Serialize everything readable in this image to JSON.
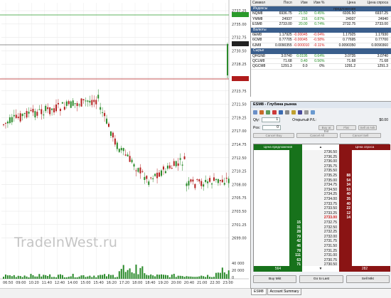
{
  "watermark": "TradeInWest.ru",
  "chart": {
    "y_ticks": [
      "2737.25",
      "2735.00",
      "2732.75",
      "2730.50",
      "2728.25",
      "2726.00",
      "2723.75",
      "2721.50",
      "2719.25",
      "2717.00",
      "2714.75",
      "2712.50",
      "2710.25",
      "2708.00",
      "2705.75",
      "2703.50",
      "2701.25",
      "2699.00"
    ],
    "x_ticks": [
      "06:50",
      "09:00",
      "10:20",
      "11:40",
      "12:40",
      "14:00",
      "15:00",
      "15:40",
      "16:20",
      "17:20",
      "18:00",
      "18:40",
      "19:20",
      "20:00",
      "20:40",
      "21:00",
      "22:30",
      "23:00"
    ],
    "vol_ticks": [
      "40 000",
      "20 000",
      "0"
    ],
    "bid_color": "#1e7a1e",
    "ask_color": "#b01c1c",
    "line_color": "#2a9a2a"
  },
  "quotes": {
    "headers": [
      "Символ",
      "Посл",
      "Изм",
      "Изм %",
      "Цена предложения",
      "Цена спроса"
    ],
    "sections": [
      {
        "name": "Индексы",
        "rows": [
          {
            "sym": "NQM8",
            "last": "6936.75",
            "chg": "21.50",
            "pct": "0.45%",
            "bid": "6936.50",
            "ask": "6937.25",
            "dir": "up"
          },
          {
            "sym": "YMM8",
            "last": "24937",
            "chg": "216",
            "pct": "0.87%",
            "bid": "24937",
            "ask": "24940",
            "dir": "up"
          },
          {
            "sym": "ESM8",
            "last": "2733.00",
            "chg": "20.00",
            "pct": "0.74%",
            "bid": "2732.75",
            "ask": "2733.00",
            "dir": "up"
          }
        ]
      },
      {
        "name": "Валюты",
        "rows": [
          {
            "sym": "6EM8",
            "last": "1.17925",
            "chg": "-0.00045",
            "pct": "-0.04%",
            "bid": "1.17925",
            "ask": "1.17930",
            "dir": "dn"
          },
          {
            "sym": "6CM8",
            "last": "0.77705",
            "chg": "-0.00045",
            "pct": "-0.58%",
            "bid": "0.77695",
            "ask": "0.77700",
            "dir": "dn"
          },
          {
            "sym": "6JM8",
            "last": "0.0090355",
            "chg": "-0.0000100",
            "pct": "-0.11%",
            "bid": "0.0090350",
            "ask": "0.0090360",
            "dir": "dn"
          }
        ]
      },
      {
        "name": "Сырье",
        "rows": [
          {
            "sym": "QHGN8",
            "last": "3.0740",
            "chg": "0.0195",
            "pct": "0.64%",
            "bid": "3.0735",
            "ask": "3.0740",
            "dir": "up"
          },
          {
            "sym": "QCLM8",
            "last": "71.68",
            "chg": "0.40",
            "pct": "0.56%",
            "bid": "71.68",
            "ask": "71.68",
            "dir": "up"
          },
          {
            "sym": "QGCM8",
            "last": "1291.3",
            "chg": "0.0",
            "pct": "0%",
            "bid": "1291.2",
            "ask": "1291.3",
            "dir": "flat"
          }
        ]
      }
    ]
  },
  "depth": {
    "title": "ESM8 - Глубина рынка",
    "qty_label": "Qty:",
    "qty_value": "1",
    "pnl_label": "Открытый P/L:",
    "pnl_value": "$0.00",
    "pos_label": "Pos:",
    "pos_value": "0",
    "btn_buy_bid": "Buy at Bid",
    "btn_sell_ask": "Sell at Ask",
    "btn_cancel_buy": "Cancel Buy",
    "btn_cancel_all": "Cancel All",
    "btn_cancel_sell": "Cancel Sell",
    "btn_flat": "Flat",
    "bid_header": "Цена предложения",
    "ask_header": "Цена спроса",
    "prices": [
      "2736.50",
      "2736.25",
      "2736.00",
      "2735.75",
      "2735.50",
      "2735.25",
      "2735.00",
      "2734.75",
      "2734.50",
      "2734.25",
      "2734.00",
      "2733.75",
      "2733.50",
      "2733.25",
      "2733.00",
      "2732.75",
      "2732.50",
      "2732.25",
      "2732.00",
      "2731.75",
      "2731.50",
      "2731.25",
      "2731.00",
      "2730.75",
      "2730.50"
    ],
    "ask_sizes": [
      "",
      "",
      "",
      "",
      "",
      "88",
      "54",
      "34",
      "53",
      "40",
      "35",
      "40",
      "22",
      "12",
      "14",
      "",
      "",
      "",
      "",
      "",
      "",
      "",
      "",
      "",
      ""
    ],
    "bid_sizes": [
      "",
      "",
      "",
      "",
      "",
      "",
      "",
      "",
      "",
      "",
      "",
      "",
      "",
      "",
      "",
      "15",
      "31",
      "28",
      "79",
      "42",
      "46",
      "78",
      "111",
      "63",
      "71"
    ],
    "last_price": "2733.00",
    "bid_total": "564",
    "ask_total": "282",
    "buy_mkt": "Buy Mkt",
    "go_last": "Go to Last",
    "sell_mkt": "Sell Mkt"
  },
  "tabs": [
    "ESM8",
    "Account Summary"
  ]
}
